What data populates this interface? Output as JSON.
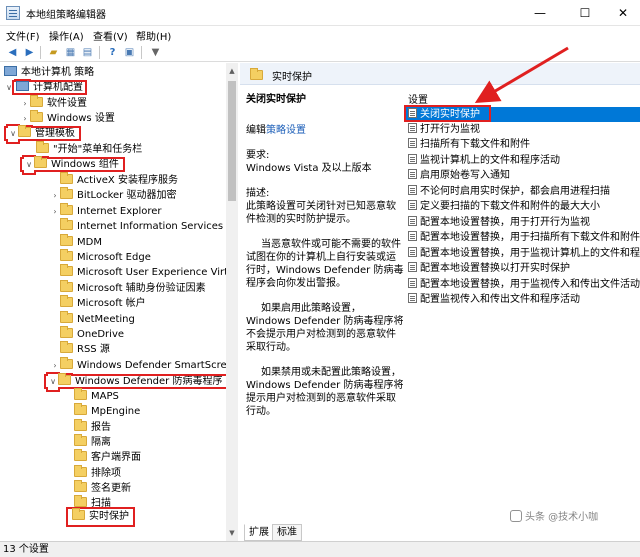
{
  "window": {
    "title": "本地组策略编辑器",
    "min": "—",
    "max": "☐",
    "close": "✕"
  },
  "menu": [
    "文件(F)",
    "操作(A)",
    "查看(V)",
    "帮助(H)"
  ],
  "toolbar_icons": [
    "back-icon",
    "forward-icon",
    "folder-up-icon",
    "show-hide-tree-icon",
    "export-list-icon",
    "help-icon",
    "properties-icon",
    "filter-icon"
  ],
  "tree": {
    "root": "本地计算机 策略",
    "computer_config": "计算机配置",
    "software_settings": "软件设置",
    "windows_settings": "Windows 设置",
    "admin_templates": "管理模板",
    "start_menu": "\"开始\"菜单和任务栏",
    "windows_components": "Windows 组件",
    "items": [
      "ActiveX 安装程序服务",
      "BitLocker 驱动器加密",
      "Internet Explorer",
      "Internet Information Services",
      "MDM",
      "Microsoft Edge",
      "Microsoft User Experience Virtu",
      "Microsoft 辅助身份验证因素",
      "Microsoft 帐户",
      "NetMeeting",
      "OneDrive",
      "RSS 源",
      "Windows Defender SmartScreen",
      "Windows Defender 防病毒程序"
    ],
    "defender_children": [
      "MAPS",
      "MpEngine",
      "报告",
      "隔离",
      "客户端界面",
      "排除项",
      "签名更新",
      "扫描",
      "实时保护"
    ]
  },
  "right": {
    "header": "实时保护",
    "desc_title": "关闭实时保护",
    "edit_prefix": "编辑",
    "edit_link": "策略设置",
    "requirements_label": "要求:",
    "requirements": "Windows Vista 及以上版本",
    "description_label": "描述:",
    "paragraphs": [
      "此策略设置可关闭针对已知恶意软件检测的实时防护提示。",
      "当恶意软件或可能不需要的软件试图在你的计算机上自行安装或运行时，Windows Defender 防病毒程序会向你发出警报。",
      "如果启用此策略设置，Windows Defender 防病毒程序将不会提示用户对检测到的恶意软件采取行动。",
      "如果禁用或未配置此策略设置，Windows Defender 防病毒程序将提示用户对检测到的恶意软件采取行动。"
    ],
    "settings_header": "设置",
    "settings": [
      "关闭实时保护",
      "打开行为监视",
      "扫描所有下载文件和附件",
      "监视计算机上的文件和程序活动",
      "启用原始卷写入通知",
      "不论何时启用实时保护，都会启用进程扫描",
      "定义要扫描的下载文件和附件的最大大小",
      "配置本地设置替换，用于打开行为监视",
      "配置本地设置替换，用于扫描所有下载文件和附件",
      "配置本地设置替换，用于监视计算机上的文件和程序",
      "配置本地设置替换以打开实时保护",
      "配置本地设置替换，用于监视传入和传出文件活动",
      "配置监视传入和传出文件和程序活动"
    ]
  },
  "tabs": [
    "扩展",
    "标准"
  ],
  "status": "13 个设置",
  "watermark": "头条 @技术小咖",
  "colors": {
    "selection": "#0078d7",
    "highlight_box": "#e02020",
    "arrow": "#e02020"
  }
}
